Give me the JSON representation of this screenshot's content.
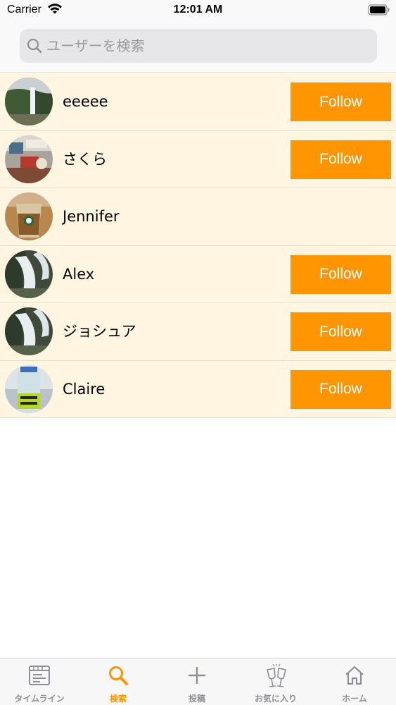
{
  "status_bar": {
    "carrier": "Carrier",
    "time": "12:01 AM"
  },
  "search": {
    "placeholder": "ユーザーを検索",
    "value": ""
  },
  "users": [
    {
      "name": "eeeee",
      "follow_label": "Follow",
      "show_follow": true
    },
    {
      "name": "さくら",
      "follow_label": "Follow",
      "show_follow": true
    },
    {
      "name": "Jennifer",
      "follow_label": "",
      "show_follow": false
    },
    {
      "name": "Alex",
      "follow_label": "Follow",
      "show_follow": true
    },
    {
      "name": "ジョシュア",
      "follow_label": "Follow",
      "show_follow": true
    },
    {
      "name": "Claire",
      "follow_label": "Follow",
      "show_follow": true
    }
  ],
  "tabs": [
    {
      "label": "タイムライン",
      "icon": "timeline-icon",
      "active": false
    },
    {
      "label": "検索",
      "icon": "search-icon",
      "active": true
    },
    {
      "label": "投稿",
      "icon": "plus-icon",
      "active": false
    },
    {
      "label": "お気に入り",
      "icon": "glasses-icon",
      "active": false
    },
    {
      "label": "ホーム",
      "icon": "home-icon",
      "active": false
    }
  ],
  "colors": {
    "accent": "#ff9500",
    "row_background": "#fff5e1",
    "tab_inactive": "#8e8e93"
  }
}
